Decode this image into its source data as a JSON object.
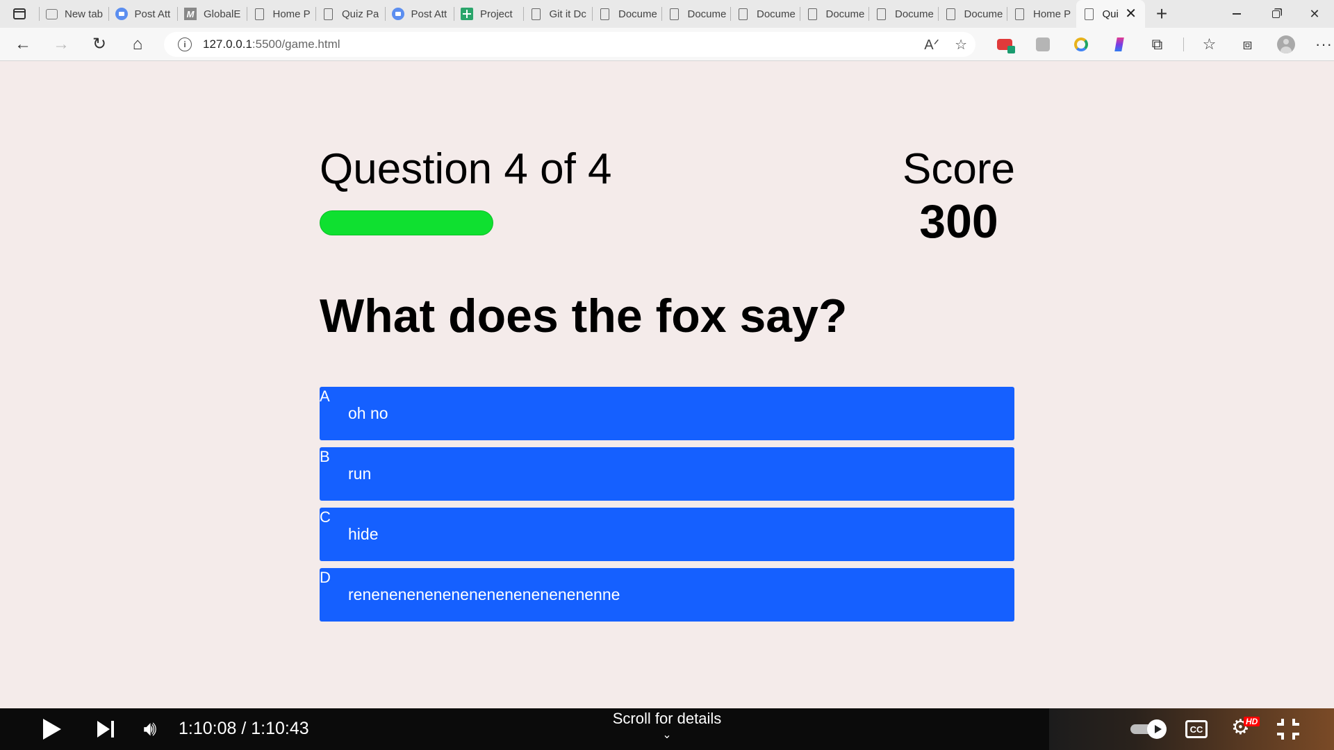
{
  "browser": {
    "tabs": [
      {
        "label": "New tab",
        "icon": "window-icon"
      },
      {
        "label": "Post Att",
        "icon": "zoom-icon"
      },
      {
        "label": "GlobalE",
        "icon": "m-logo-icon"
      },
      {
        "label": "Home P",
        "icon": "document-icon"
      },
      {
        "label": "Quiz Pa",
        "icon": "document-icon"
      },
      {
        "label": "Post Att",
        "icon": "zoom-icon"
      },
      {
        "label": "Project",
        "icon": "sheets-plus-icon"
      },
      {
        "label": "Git it Dc",
        "icon": "document-icon"
      },
      {
        "label": "Docume",
        "icon": "document-icon"
      },
      {
        "label": "Docume",
        "icon": "document-icon"
      },
      {
        "label": "Docume",
        "icon": "document-icon"
      },
      {
        "label": "Docume",
        "icon": "document-icon"
      },
      {
        "label": "Docume",
        "icon": "document-icon"
      },
      {
        "label": "Docume",
        "icon": "document-icon"
      },
      {
        "label": "Home P",
        "icon": "document-icon"
      }
    ],
    "active_tab": {
      "label": "Qui",
      "close": "✕"
    },
    "new_tab": "+",
    "url_host": "127.0.0.1",
    "url_rest": ":5500/game.html"
  },
  "quiz": {
    "progress_text": "Question 4 of 4",
    "progress_fraction": 0.25,
    "score_label": "Score",
    "score_value": "300",
    "question": "What does the fox say?",
    "choices": [
      {
        "prefix": "A",
        "text": "oh no"
      },
      {
        "prefix": "B",
        "text": "run"
      },
      {
        "prefix": "C",
        "text": "hide"
      },
      {
        "prefix": "D",
        "text": "renenenenenenenenenenenenenenne"
      }
    ],
    "colors": {
      "background": "#f4ebea",
      "choice": "#1560ff",
      "progress": "#0fe030"
    }
  },
  "player": {
    "timecode": "1:10:08 / 1:10:43",
    "scroll_hint": "Scroll for details",
    "cc_label": "CC",
    "quality_badge": "HD"
  }
}
